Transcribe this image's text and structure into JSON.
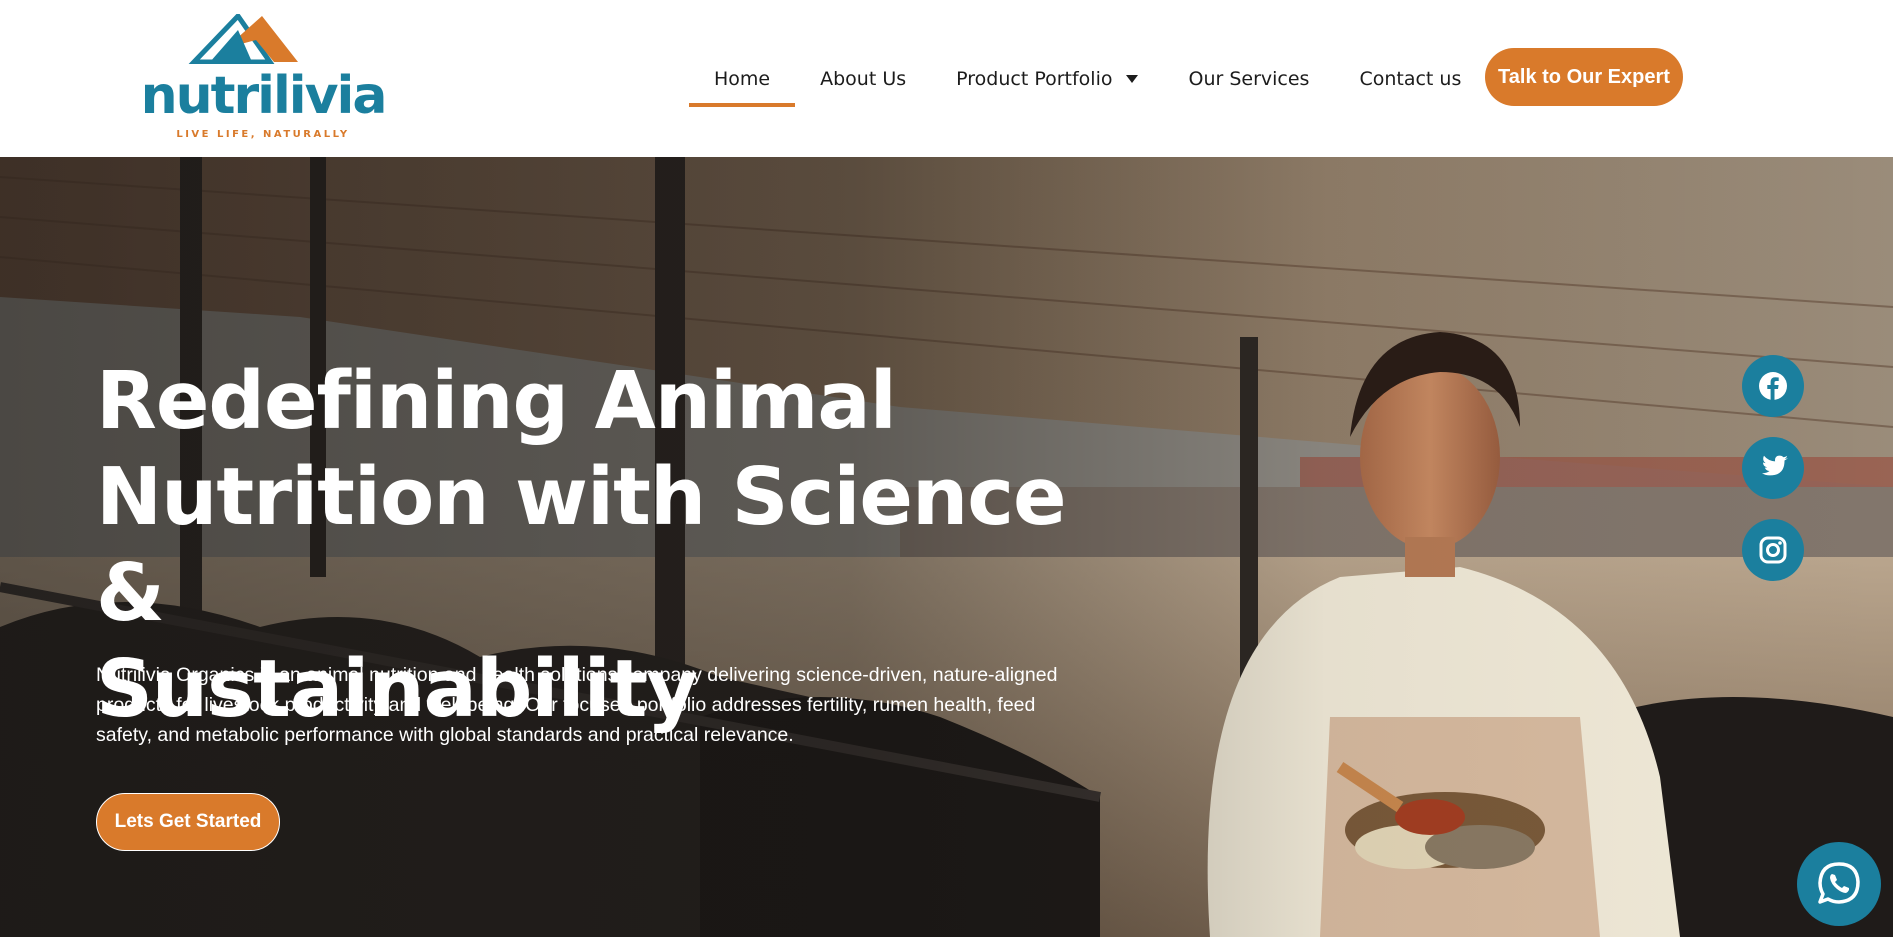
{
  "brand": {
    "name": "nutrilivia",
    "tagline": "LIVE LIFE, NATURALLY",
    "colors": {
      "primary": "#1b7f9e",
      "accent": "#d97a2b"
    }
  },
  "nav": {
    "items": [
      {
        "label": "Home",
        "active": true
      },
      {
        "label": "About Us",
        "active": false
      },
      {
        "label": "Product Portfolio",
        "active": false,
        "has_dropdown": true
      },
      {
        "label": "Our Services",
        "active": false
      },
      {
        "label": "Contact us",
        "active": false
      }
    ],
    "cta_label": "Talk to Our Expert"
  },
  "hero": {
    "title_lines": [
      "Redefining Animal",
      "Nutrition with Science &",
      "Sustainability"
    ],
    "description_lines": [
      "Nutrilivia Organics is an animal nutrition and health solutions company delivering science-driven, nature-aligned",
      "products for livestock productivity and well-being. Our focused portfolio addresses fertility, rumen health, feed",
      "safety, and metabolic performance with global standards and practical relevance."
    ],
    "cta_label": "Lets Get Started"
  },
  "social": {
    "icons": [
      "facebook-icon",
      "twitter-icon",
      "instagram-icon"
    ],
    "chat_icon": "whatsapp-icon"
  }
}
